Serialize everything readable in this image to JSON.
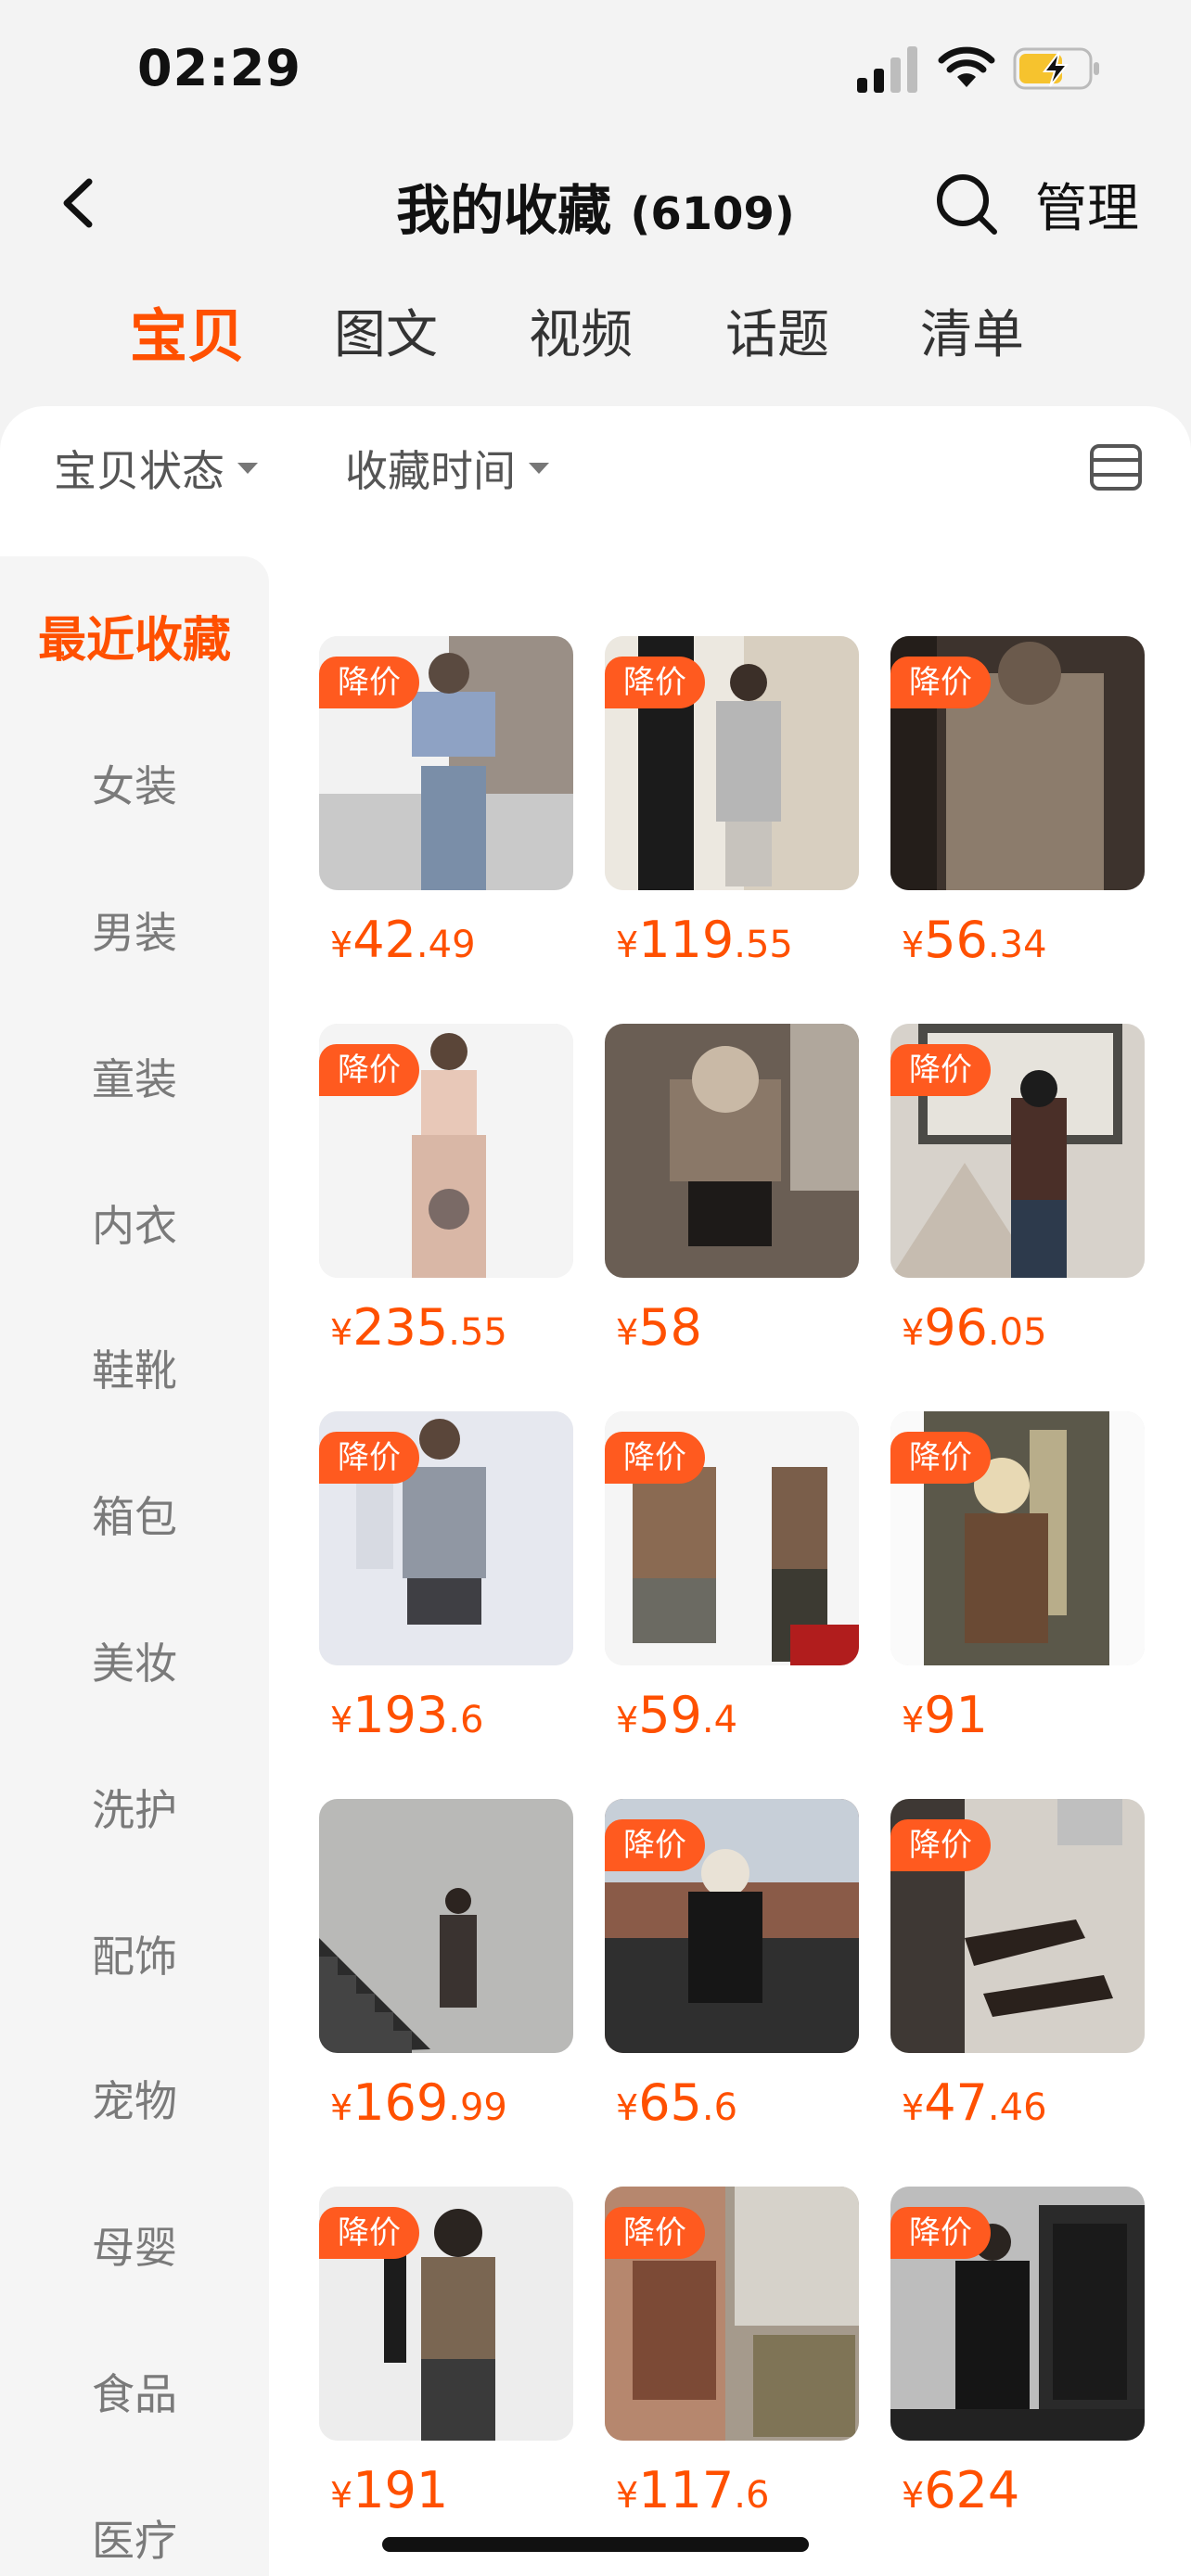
{
  "status_bar": {
    "time": "02:29"
  },
  "nav": {
    "title": "我的收藏",
    "count": "(6109)",
    "manage": "管理"
  },
  "tabs": [
    "宝贝",
    "图文",
    "视频",
    "话题",
    "清单"
  ],
  "filters": {
    "status": "宝贝状态",
    "time": "收藏时间"
  },
  "sidebar": [
    "最近收藏",
    "女装",
    "男装",
    "童装",
    "内衣",
    "鞋靴",
    "箱包",
    "美妆",
    "洗护",
    "配饰",
    "宠物",
    "母婴",
    "食品",
    "医疗"
  ],
  "badge_label": "降价",
  "currency": "¥",
  "products": [
    {
      "price_int": "42",
      "price_dec": ".49",
      "badge": true
    },
    {
      "price_int": "119",
      "price_dec": ".55",
      "badge": true
    },
    {
      "price_int": "56",
      "price_dec": ".34",
      "badge": true
    },
    {
      "price_int": "235",
      "price_dec": ".55",
      "badge": true
    },
    {
      "price_int": "58",
      "price_dec": "",
      "badge": false
    },
    {
      "price_int": "96",
      "price_dec": ".05",
      "badge": true
    },
    {
      "price_int": "193",
      "price_dec": ".6",
      "badge": true
    },
    {
      "price_int": "59",
      "price_dec": ".4",
      "badge": true
    },
    {
      "price_int": "91",
      "price_dec": "",
      "badge": true
    },
    {
      "price_int": "169",
      "price_dec": ".99",
      "badge": false
    },
    {
      "price_int": "65",
      "price_dec": ".6",
      "badge": true
    },
    {
      "price_int": "47",
      "price_dec": ".46",
      "badge": true
    },
    {
      "price_int": "191",
      "price_dec": "",
      "badge": true
    },
    {
      "price_int": "117",
      "price_dec": ".6",
      "badge": true
    },
    {
      "price_int": "624",
      "price_dec": "",
      "badge": true
    }
  ],
  "colors": {
    "accent": "#ff5000",
    "badge_bg": "#ff5a1f",
    "background": "#f3f3f3",
    "sidebar_bg": "#f5f5f5"
  }
}
